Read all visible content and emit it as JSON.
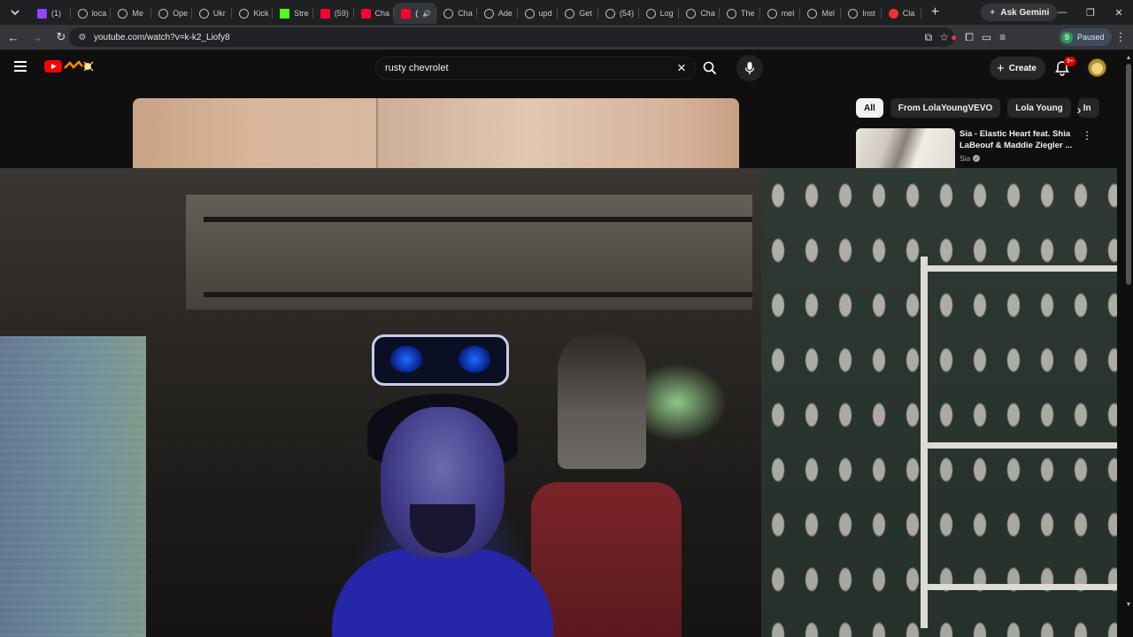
{
  "browser": {
    "tabs": [
      {
        "label": "(1) ",
        "icon": "twitch-icon",
        "color": "#9146ff"
      },
      {
        "label": "loca",
        "icon": "globe-icon"
      },
      {
        "label": "Me",
        "icon": "globe-icon"
      },
      {
        "label": "Ope",
        "icon": "globe-icon"
      },
      {
        "label": "Ukr",
        "icon": "globe-icon"
      },
      {
        "label": "Kick",
        "icon": "globe-icon"
      },
      {
        "label": "Stre",
        "icon": "kick-icon",
        "color": "#53fc18"
      },
      {
        "label": "(59)",
        "icon": "youtube-icon",
        "color": "#ff0033"
      },
      {
        "label": "Cha",
        "icon": "youtube-icon",
        "color": "#ff0033"
      },
      {
        "label": "(",
        "icon": "youtube-icon",
        "active": true
      },
      {
        "label": "Cha",
        "icon": "globe-icon"
      },
      {
        "label": "Ade",
        "icon": "globe-icon"
      },
      {
        "label": "upd",
        "icon": "globe-icon"
      },
      {
        "label": "Get",
        "icon": "globe-icon"
      },
      {
        "label": "(54)",
        "icon": "globe-icon"
      },
      {
        "label": "Log",
        "icon": "globe-icon"
      },
      {
        "label": "Cha",
        "icon": "globe-icon"
      },
      {
        "label": "The",
        "icon": "globe-icon"
      },
      {
        "label": "mel",
        "icon": "globe-icon"
      },
      {
        "label": "Mel",
        "icon": "globe-icon"
      },
      {
        "label": "Inst",
        "icon": "globe-icon"
      },
      {
        "label": "Cla",
        "icon": "claude-icon",
        "color": "#e33"
      }
    ],
    "ask_gemini": "Ask Gemini",
    "url": "youtube.com/watch?v=k-k2_Liofy8",
    "profile_initial": "B",
    "profile_status": "Paused"
  },
  "youtube": {
    "search_query": "rusty chevrolet",
    "create_label": "Create",
    "notification_count": "9+",
    "chips": [
      "All",
      "From LolaYoungVEVO",
      "Lola Young",
      "In"
    ],
    "recommendation": {
      "title": "Sia - Elastic Heart feat. Shia LaBeouf & Maddie Ziegler ...",
      "channel": "Sia"
    }
  },
  "colors": {
    "accent_red": "#ff0000",
    "badge_red": "#cc0000",
    "chip_active_bg": "#f1f1f1",
    "page_bg": "#0f0f0f"
  }
}
